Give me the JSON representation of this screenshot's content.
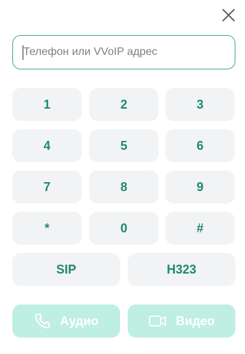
{
  "dialer": {
    "input": {
      "value": "",
      "placeholder": "Телефон или VVoIP адрес"
    },
    "keys": [
      "1",
      "2",
      "3",
      "4",
      "5",
      "6",
      "7",
      "8",
      "9",
      "*",
      "0",
      "#"
    ],
    "protocols": {
      "sip_label": "SIP",
      "h323_label": "H323"
    },
    "actions": {
      "audio_label": "Аудио",
      "video_label": "Видео"
    }
  },
  "icons": {
    "close": "close-icon",
    "phone": "phone-icon",
    "video": "video-camera-icon"
  },
  "colors": {
    "accent": "#1e8a6b",
    "input_border": "#3aa88a",
    "key_background": "#f2f3f5",
    "call_button_disabled": "#bfeee3"
  }
}
